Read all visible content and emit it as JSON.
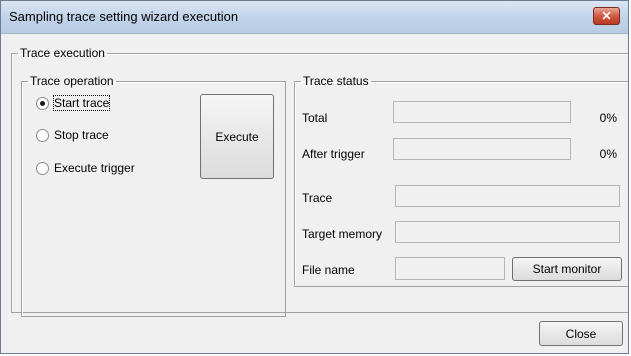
{
  "window": {
    "title": "Sampling trace setting wizard execution",
    "close_glyph": "✕"
  },
  "trace_execution": {
    "legend": "Trace execution",
    "trace_operation": {
      "legend": "Trace operation",
      "options": [
        {
          "label": "Start trace",
          "selected": true
        },
        {
          "label": "Stop trace",
          "selected": false
        },
        {
          "label": "Execute trigger",
          "selected": false
        }
      ],
      "execute_label": "Execute"
    },
    "trace_status": {
      "legend": "Trace status",
      "total_label": "Total",
      "total_percent": "0%",
      "after_trigger_label": "After trigger",
      "after_trigger_percent": "0%",
      "trace_label": "Trace",
      "trace_value": "",
      "target_memory_label": "Target memory",
      "target_memory_value": "",
      "file_name_label": "File name",
      "file_name_value": "",
      "start_monitor_label": "Start monitor"
    }
  },
  "footer": {
    "close_label": "Close"
  }
}
